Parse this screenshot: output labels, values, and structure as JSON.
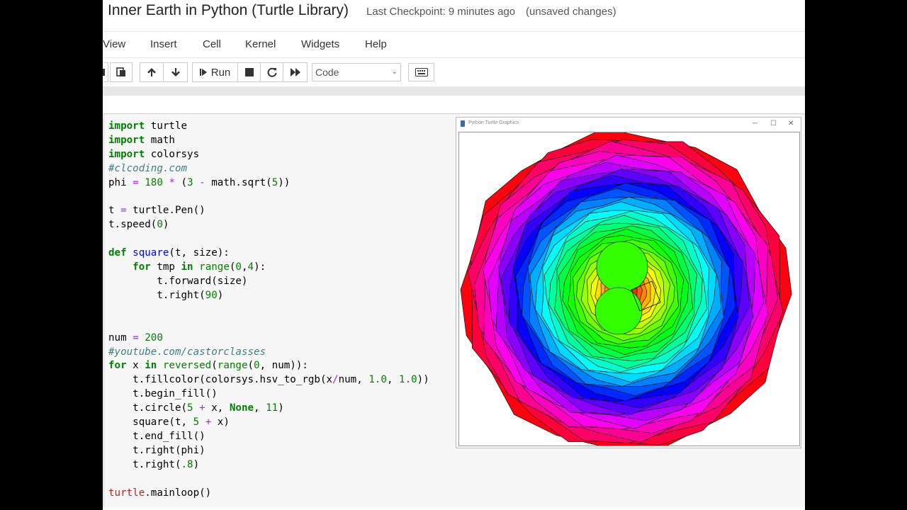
{
  "header": {
    "title": "Inner Earth in Python (Turtle Library)",
    "checkpoint": "Last Checkpoint: 9 minutes ago",
    "unsaved": "(unsaved changes)"
  },
  "menu": [
    "View",
    "Insert",
    "Cell",
    "Kernel",
    "Widgets",
    "Help"
  ],
  "toolbar": {
    "run_label": "Run",
    "cell_type": "Code"
  },
  "code_cell": {
    "lines": [
      "import turtle",
      "import math",
      "import colorsys",
      "#clcoding.com",
      "phi = 180 * (3 - math.sqrt(5))",
      "",
      "t = turtle.Pen()",
      "t.speed(0)",
      "",
      "def square(t, size):",
      "    for tmp in range(0,4):",
      "        t.forward(size)",
      "        t.right(90)",
      "",
      "",
      "num = 200",
      "#youtube.com/castorclasses",
      "for x in reversed(range(0, num)):",
      "    t.fillcolor(colorsys.hsv_to_rgb(x/num, 1.0, 1.0))",
      "    t.begin_fill()",
      "    t.circle(5 + x, None, 11)",
      "    square(t, 5 + x)",
      "    t.end_fill()",
      "    t.right(phi)",
      "    t.right(.8)",
      "",
      "turtle.mainloop()"
    ]
  },
  "turtle_window": {
    "title": "Python Turtle Graphics"
  }
}
